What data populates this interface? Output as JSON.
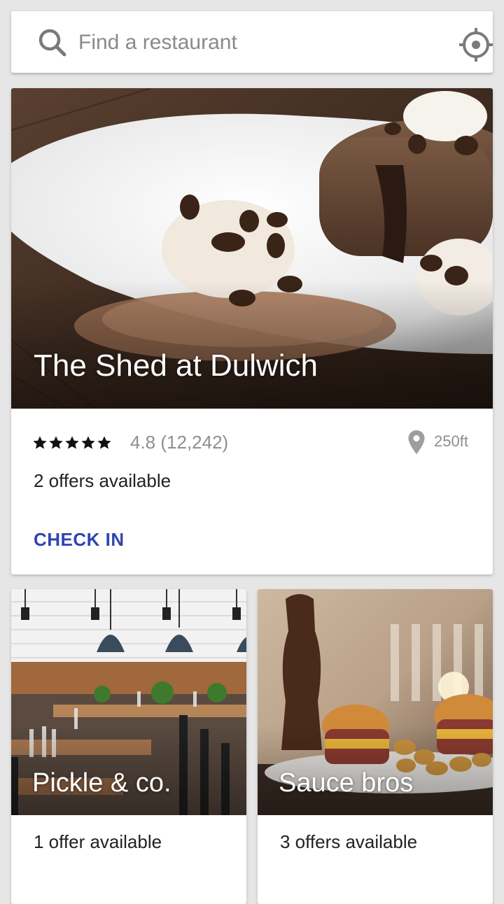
{
  "search": {
    "placeholder": "Find a restaurant",
    "icon": "search-icon",
    "locate_icon": "crosshair-icon"
  },
  "featured": {
    "name": "The Shed at Dulwich",
    "stars": 5,
    "rating": "4.8 (12,242)",
    "distance": "250ft",
    "offers": "2 offers available",
    "action": "CHECK IN",
    "action_color": "#3045b0"
  },
  "restaurants": [
    {
      "name": "Pickle & co.",
      "offers": "1 offer available"
    },
    {
      "name": "Sauce bros",
      "offers": "3 offers available"
    }
  ],
  "colors": {
    "background": "#e6e6e6",
    "accent": "#3045b0",
    "muted_text": "#8f8f8f"
  }
}
